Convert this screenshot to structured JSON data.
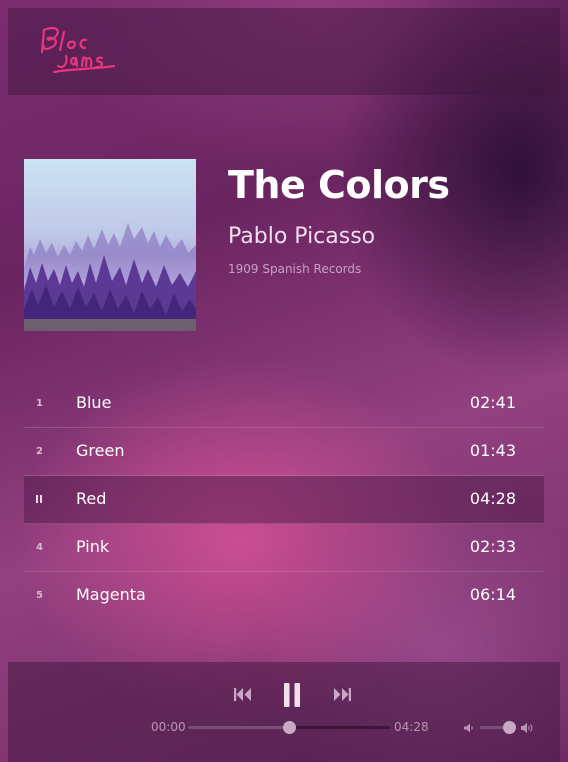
{
  "header": {
    "logo_icon": "bloc-jams-logo",
    "logo_text": "Bloc Jams",
    "logo_color": "#e8357f"
  },
  "album": {
    "art_icon": "foggy-forest-album-art",
    "title": "The Colors",
    "artist": "Pablo Picasso",
    "label": "1909 Spanish Records"
  },
  "tracks": [
    {
      "number": "1",
      "title": "Blue",
      "duration": "02:41",
      "playing": false
    },
    {
      "number": "2",
      "title": "Green",
      "duration": "01:43",
      "playing": false
    },
    {
      "number": "3",
      "title": "Red",
      "duration": "04:28",
      "playing": true
    },
    {
      "number": "4",
      "title": "Pink",
      "duration": "02:33",
      "playing": false
    },
    {
      "number": "5",
      "title": "Magenta",
      "duration": "06:14",
      "playing": false
    }
  ],
  "player": {
    "prev_icon": "previous-track-icon",
    "pause_icon": "pause-icon",
    "next_icon": "next-track-icon",
    "current_time": "00:00",
    "total_time": "04:28",
    "seek_fraction": 0.5,
    "volume_fraction": 0.8,
    "volume_low_icon": "volume-low-icon",
    "volume_high_icon": "volume-high-icon"
  }
}
